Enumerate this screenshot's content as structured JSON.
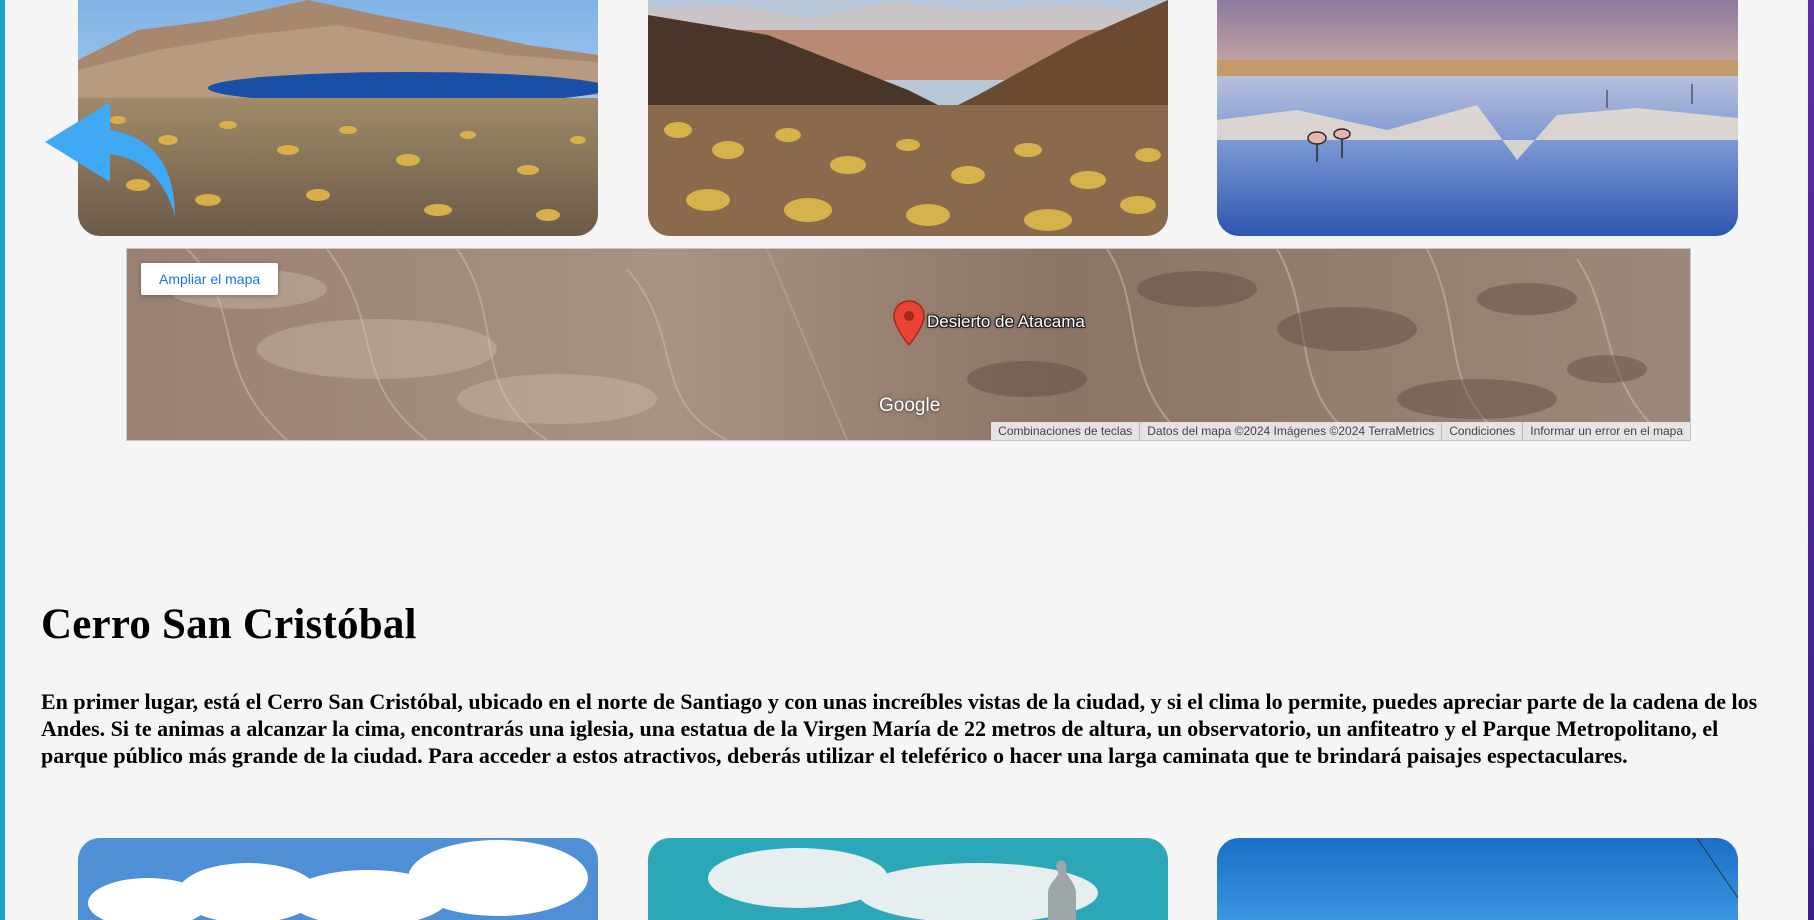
{
  "map": {
    "expand_label": "Ampliar el mapa",
    "pin_label": "Desierto de Atacama",
    "logo": "Google",
    "attribution": {
      "shortcuts": "Combinaciones de teclas",
      "data": "Datos del mapa ©2024 Imágenes ©2024 TerraMetrics",
      "terms": "Condiciones",
      "report": "Informar un error en el mapa"
    }
  },
  "section": {
    "title": "Cerro San Cristóbal",
    "body": "En primer lugar, está el Cerro San Cristóbal, ubicado en el norte de Santiago y con unas increíbles vistas de la ciudad, y si el clima lo permite, puedes apreciar parte de la cadena de los Andes. Si te animas a alcanzar la cima, encontrarás una iglesia, una estatua de la Virgen María de 22 metros de altura, un observatorio, un anfiteatro y el Parque Metropolitano, el parque público más grande de la ciudad. Para acceder a estos atractivos, deberás utilizar el teleférico o hacer una larga caminata que te brindará paisajes espectaculares."
  },
  "icons": {
    "back": "back-arrow-icon",
    "pin": "map-pin-icon"
  },
  "colors": {
    "page_bg": "#f5f5f5",
    "arrow": "#3fa9f5",
    "link_blue": "#1a73e8",
    "pin_red": "#ea4335"
  }
}
